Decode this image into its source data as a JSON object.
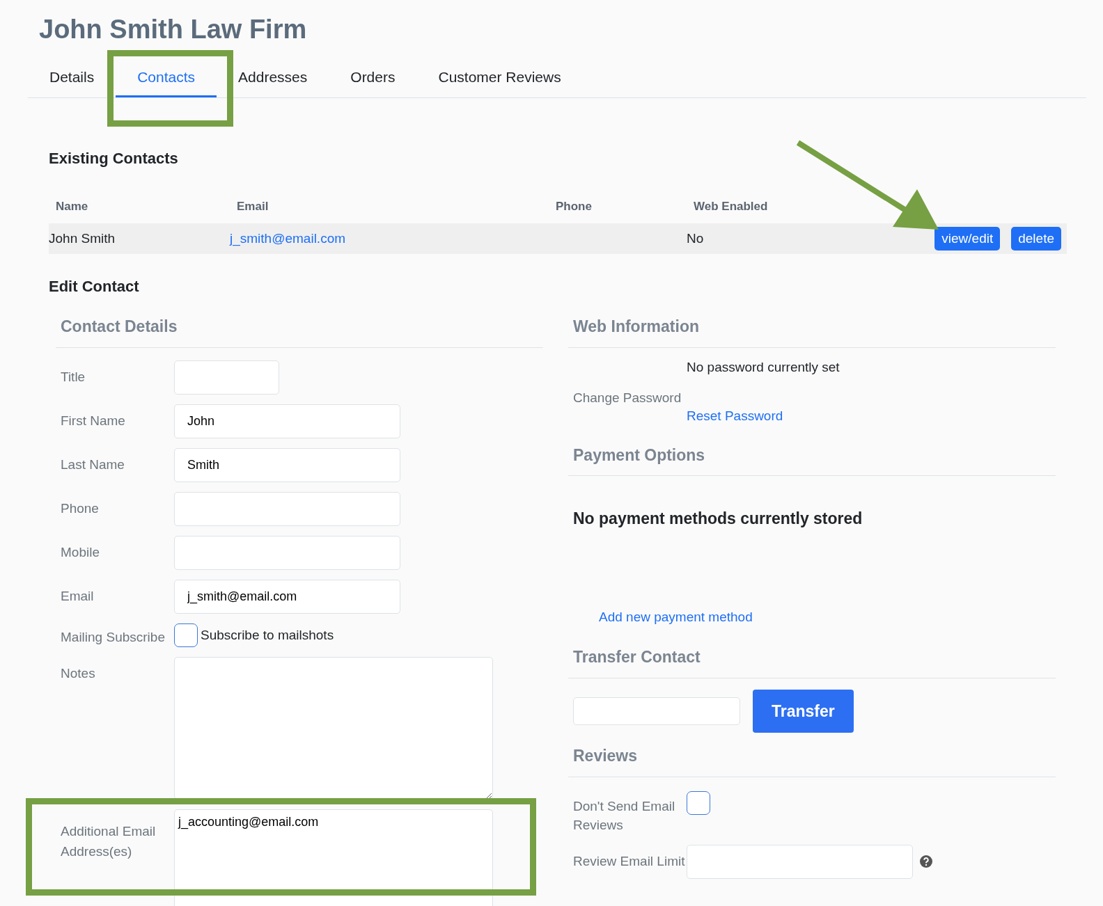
{
  "title": "John Smith Law Firm",
  "tabs": [
    {
      "label": "Details",
      "selected": false
    },
    {
      "label": "Contacts",
      "selected": true
    },
    {
      "label": "Addresses",
      "selected": false
    },
    {
      "label": "Orders",
      "selected": false
    },
    {
      "label": "Customer Reviews",
      "selected": false
    }
  ],
  "existing_contacts": {
    "heading": "Existing Contacts",
    "columns": [
      "Name",
      "Email",
      "Phone",
      "Web Enabled"
    ],
    "rows": [
      {
        "name": "John Smith",
        "email": "j_smith@email.com",
        "web_enabled": "No",
        "actions": [
          "view/edit",
          "delete"
        ]
      }
    ]
  },
  "edit_heading": "Edit Contact",
  "contact_details": {
    "heading": "Contact Details",
    "fields": [
      {
        "kind": "short",
        "label": "Title"
      },
      {
        "kind": "input",
        "label": "First Name",
        "value": "John"
      },
      {
        "kind": "input",
        "label": "Last Name",
        "value": "Smith"
      },
      {
        "kind": "input",
        "label": "Phone"
      },
      {
        "kind": "input",
        "label": "Mobile"
      },
      {
        "kind": "input",
        "label": "Email",
        "value": "j_smith@email.com"
      },
      {
        "kind": "checkbox",
        "label": "Mailing Subscribe",
        "option": "Subscribe to mailshots",
        "checked": false
      },
      {
        "kind": "textarea",
        "label": "Notes"
      },
      {
        "kind": "textarea",
        "label": "Additional Email Address(es)",
        "value": "j_accounting@email.com"
      }
    ]
  },
  "web_information": {
    "heading": "Web Information",
    "status": "No password currently set",
    "label": "Change Password",
    "link": "Reset Password"
  },
  "payment_options": {
    "heading": "Payment Options",
    "message": "No payment methods currently stored",
    "link": "Add new payment method"
  },
  "transfer_contact": {
    "heading": "Transfer Contact",
    "button": "Transfer"
  },
  "reviews": {
    "heading": "Reviews",
    "fields": [
      {
        "kind": "checkbox",
        "label": "Don't Send Email Reviews",
        "checked": false
      },
      {
        "kind": "input",
        "label": "Review Email Limit",
        "help": true
      }
    ]
  }
}
